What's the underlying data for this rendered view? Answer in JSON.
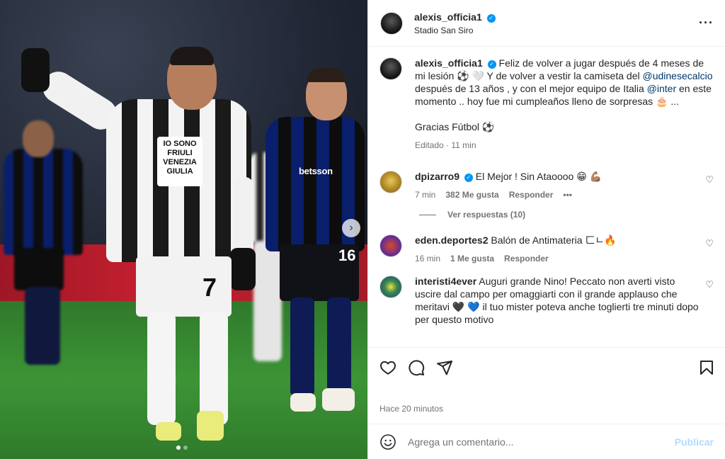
{
  "post": {
    "media": {
      "sponsor_text": "IO SONO FRIULI VENEZIA GIULIA",
      "number_main": "7",
      "sponsor_inter": "betsson",
      "number_inter": "16",
      "next_icon": "chevron-right-icon",
      "slides": 2,
      "active_slide": 1
    },
    "author": {
      "username": "alexis_officia1",
      "verified": true,
      "location": "Stadio San Siro"
    },
    "caption": {
      "username": "alexis_officia1",
      "text_1": "Feliz de volver a jugar después de 4 meses de mi lesión ⚽ 🤍 Y de volver a vestir la camiseta del ",
      "mention_1": "@udinesecalcio",
      "text_2": " después de 13 años , y con el mejor equipo de Italia ",
      "mention_2": "@inter",
      "text_3": " en este momento .. hoy fue mi cumpleaños lleno de sorpresas 🎂 ...",
      "text_4": "Gracias Fútbol ⚽",
      "meta": "Editado · 11 min"
    },
    "comments": [
      {
        "username": "dpizarro9",
        "verified": true,
        "text": "El Mejor ! Sin Ataoooo 😁 💪🏽",
        "time": "7 min",
        "likes": "382 Me gusta",
        "reply": "Responder",
        "more": "•••"
      },
      {
        "username": "eden.deportes2",
        "verified": false,
        "text": "Balón de Antimateria ㄈㄴ🔥",
        "time": "16 min",
        "likes": "1 Me gusta",
        "reply": "Responder"
      },
      {
        "username": "interisti4ever",
        "verified": false,
        "text": "Auguri grande Nino! Peccato non averti visto uscire dal campo per omaggiarti con il grande applauso che meritavi 🖤 💙 il tuo mister poteva anche toglierti tre minuti dopo per questo motivo"
      }
    ],
    "view_replies": "Ver respuestas (10)",
    "timestamp": "Hace 20 minutos",
    "composer": {
      "placeholder": "Agrega un comentario...",
      "publish": "Publicar"
    },
    "icons": {
      "more": "more-horizontal-icon",
      "like": "heart-icon",
      "comment": "comment-icon",
      "share": "share-icon",
      "save": "bookmark-icon",
      "emoji": "emoji-icon"
    },
    "colors": {
      "accent": "#0095f6",
      "publish_disabled": "#b3dbff",
      "mention": "#00376b",
      "muted": "#737373"
    }
  }
}
